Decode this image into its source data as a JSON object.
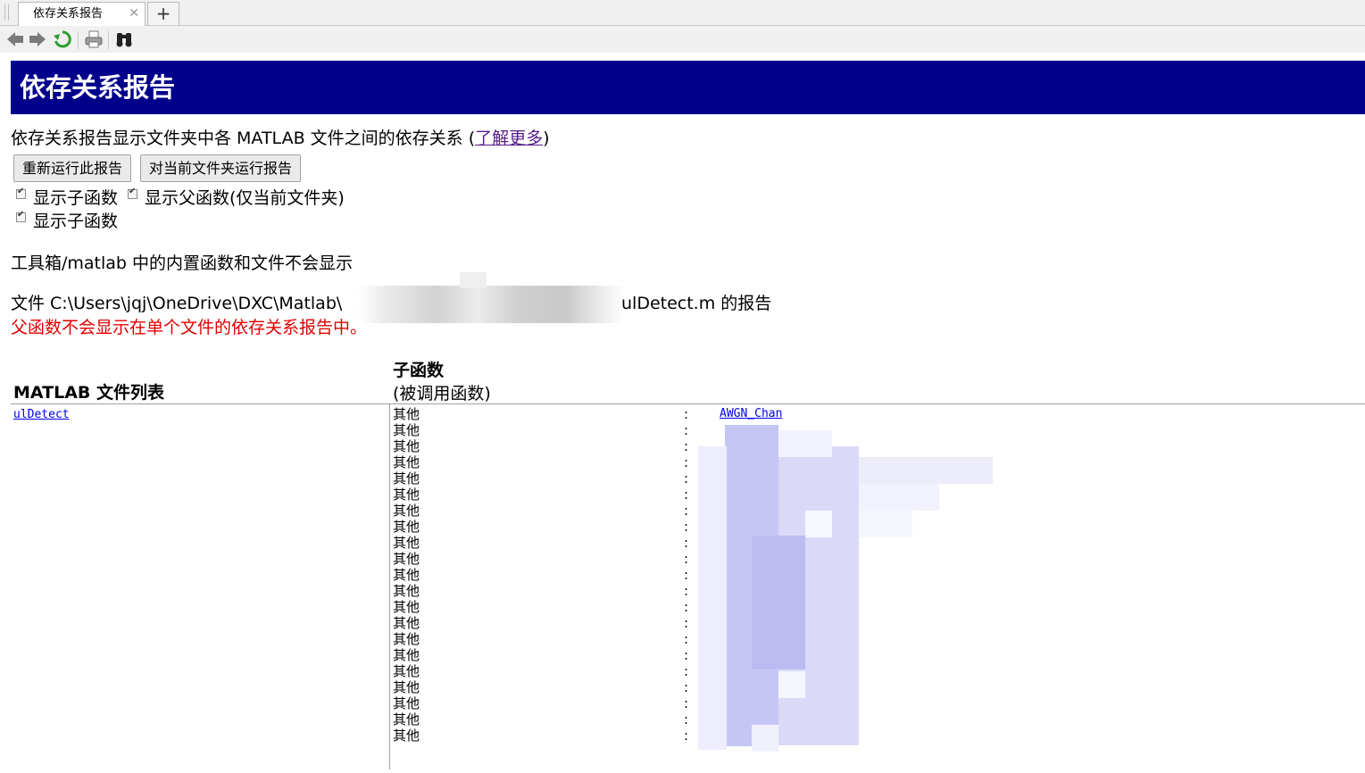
{
  "tabs": [
    {
      "label": "依存关系报告"
    }
  ],
  "toolbar": {
    "buttons": [
      {
        "name": "back-icon"
      },
      {
        "name": "forward-icon"
      },
      {
        "name": "refresh-icon"
      },
      {
        "name": "print-icon"
      },
      {
        "name": "find-icon"
      }
    ]
  },
  "header": {
    "title": "依存关系报告"
  },
  "description": {
    "text": "依存关系报告显示文件夹中各 MATLAB 文件之间的依存关系 (",
    "link": "了解更多",
    "suffix": ")"
  },
  "actions": {
    "rerun_label": "重新运行此报告",
    "run_current_label": "对当前文件夹运行报告"
  },
  "options": {
    "show_subfunctions": "显示子函数",
    "show_parent": "显示父函数(仅当前文件夹)",
    "show_subfunctions_2": "显示子函数"
  },
  "notes": {
    "toolbox_note": "工具箱/matlab 中的内置函数和文件不会显示",
    "file_prefix": "文件 C:\\Users\\jqj\\OneDrive\\DXC\\Matlab\\",
    "file_suffix": "ulDetect.m 的报告",
    "warning": "父函数不会显示在单个文件的依存关系报告中。"
  },
  "table": {
    "col1_header": "MATLAB 文件列表",
    "col2_header": "子函数",
    "col2_subheader": "(被调用函数)",
    "file": "ulDetect",
    "rows": [
      {
        "type": "其他",
        "sep": ":",
        "fn": "AWGN_Chan"
      },
      {
        "type": "其他",
        "sep": ":",
        "fn": ""
      },
      {
        "type": "其他",
        "sep": ":",
        "fn": ""
      },
      {
        "type": "其他",
        "sep": ":",
        "fn": ""
      },
      {
        "type": "其他",
        "sep": ":",
        "fn": ""
      },
      {
        "type": "其他",
        "sep": ":",
        "fn": ""
      },
      {
        "type": "其他",
        "sep": ":",
        "fn": ""
      },
      {
        "type": "其他",
        "sep": ":",
        "fn": ""
      },
      {
        "type": "其他",
        "sep": ":",
        "fn": ""
      },
      {
        "type": "其他",
        "sep": ":",
        "fn": ""
      },
      {
        "type": "其他",
        "sep": ":",
        "fn": ""
      },
      {
        "type": "其他",
        "sep": ":",
        "fn": ""
      },
      {
        "type": "其他",
        "sep": ":",
        "fn": ""
      },
      {
        "type": "其他",
        "sep": ":",
        "fn": ""
      },
      {
        "type": "其他",
        "sep": ":",
        "fn": ""
      },
      {
        "type": "其他",
        "sep": ":",
        "fn": ""
      },
      {
        "type": "其他",
        "sep": ":",
        "fn": ""
      },
      {
        "type": "其他",
        "sep": ":",
        "fn": ""
      },
      {
        "type": "其他",
        "sep": ":",
        "fn": ""
      },
      {
        "type": "其他",
        "sep": ":",
        "fn": ""
      },
      {
        "type": "其他",
        "sep": ":",
        "fn": ""
      }
    ]
  },
  "colors": {
    "banner": "#00008b",
    "link": "#0000ee",
    "visited_link": "#551a8b",
    "warning": "#e00000"
  }
}
